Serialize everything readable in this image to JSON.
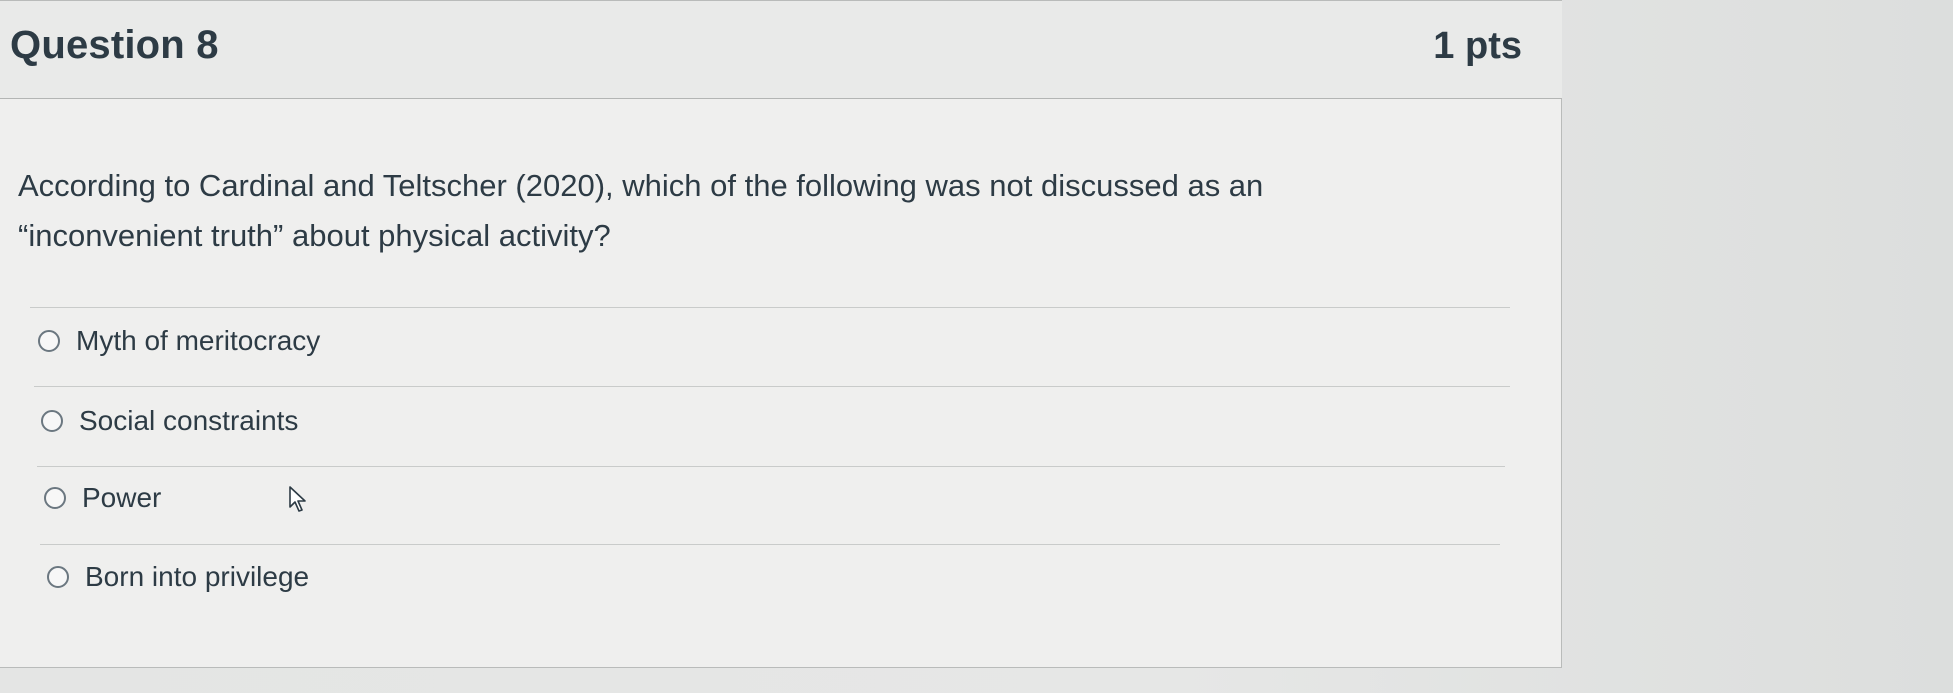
{
  "question": {
    "title": "Question 8",
    "points": "1 pts",
    "text": "According to Cardinal and Teltscher (2020), which of the following was not discussed as an “inconvenient truth” about physical activity?"
  },
  "answers": [
    {
      "label": "Myth of meritocracy",
      "selected": false
    },
    {
      "label": "Social constraints",
      "selected": false
    },
    {
      "label": "Power",
      "selected": false
    },
    {
      "label": "Born into privilege",
      "selected": false
    }
  ],
  "colors": {
    "text": "#2d3b45",
    "header_bg": "#e9eae9",
    "card_bg": "#efefee",
    "page_bg": "#e6e7e6"
  },
  "icons": {
    "cursor": "mouse-pointer-icon",
    "radio": "radio-button-icon"
  }
}
